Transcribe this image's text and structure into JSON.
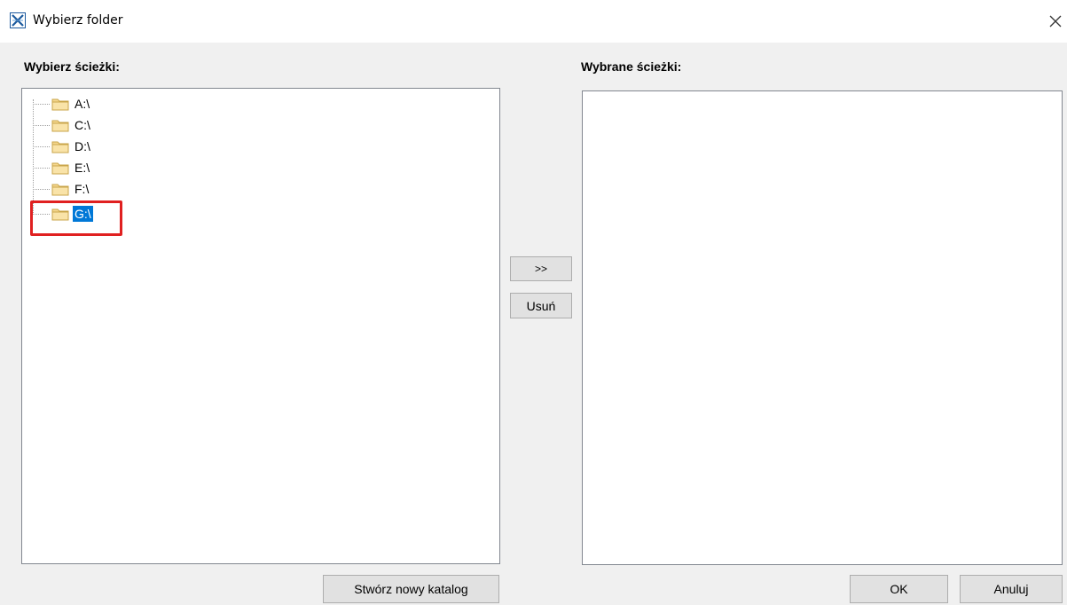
{
  "window": {
    "title": "Wybierz folder",
    "icon": "app-x-icon",
    "close_icon": "close-icon"
  },
  "left_panel": {
    "label": "Wybierz ścieżki:",
    "tree": [
      {
        "label": "A:\\",
        "selected": false
      },
      {
        "label": "C:\\",
        "selected": false
      },
      {
        "label": "D:\\",
        "selected": false
      },
      {
        "label": "E:\\",
        "selected": false
      },
      {
        "label": "F:\\",
        "selected": false
      },
      {
        "label": "G:\\",
        "selected": true
      }
    ]
  },
  "right_panel": {
    "label": "Wybrane ścieżki:"
  },
  "middle_buttons": {
    "add_label": ">>",
    "remove_label": "Usuń"
  },
  "footer": {
    "new_folder_label": "Stwórz nowy katalog",
    "ok_label": "OK",
    "cancel_label": "Anuluj"
  },
  "colors": {
    "selection": "#0078d7",
    "annotation": "#e02020",
    "folder": "#f5d78e"
  }
}
